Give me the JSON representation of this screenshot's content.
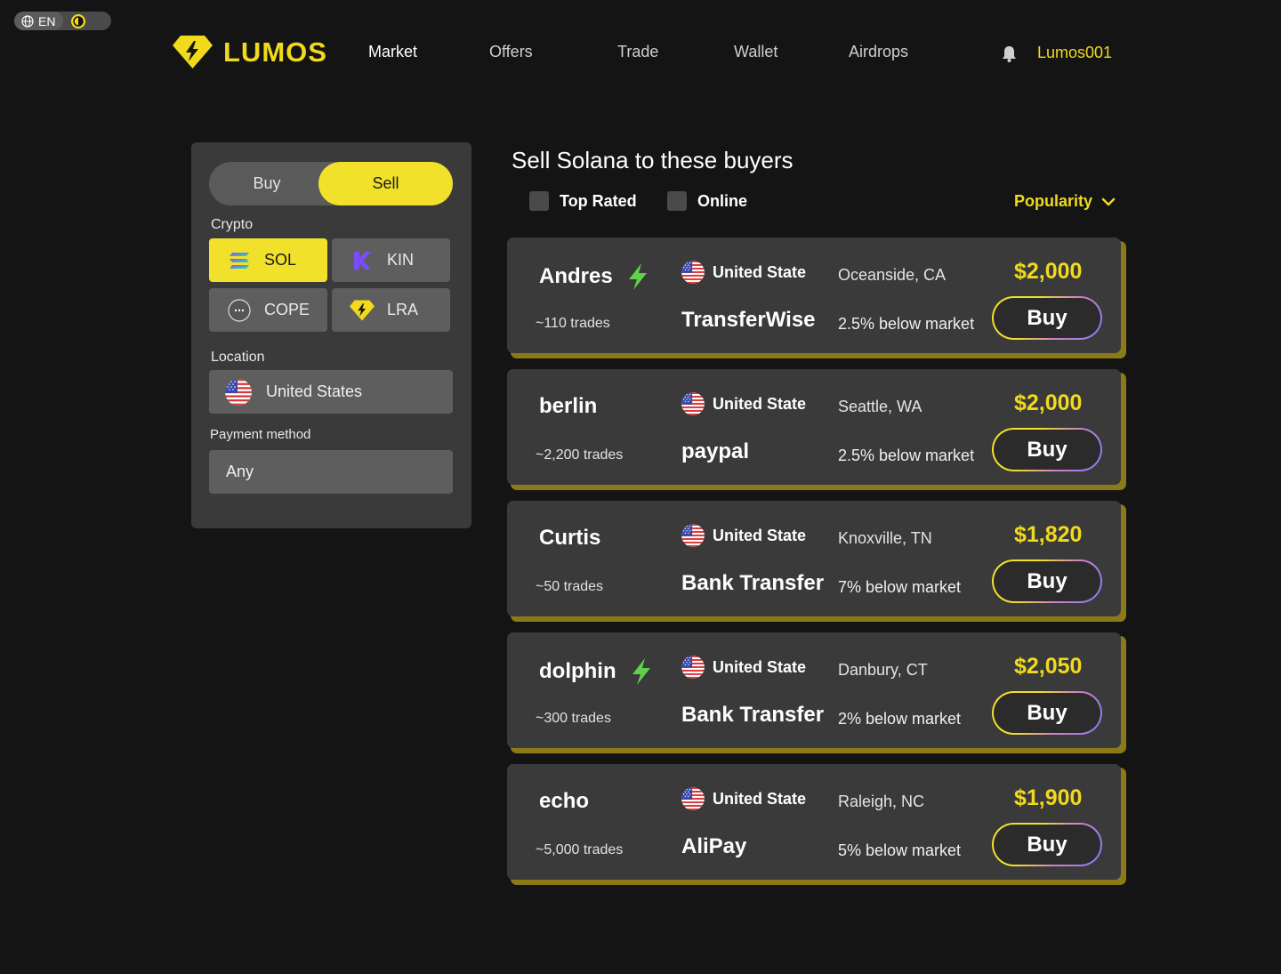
{
  "util": {
    "language": "EN"
  },
  "header": {
    "brand": "LUMOS",
    "nav": [
      "Market",
      "Offers",
      "Trade",
      "Wallet",
      "Airdrops"
    ],
    "active_nav": "Market",
    "username": "Lumos001"
  },
  "filters": {
    "toggle": {
      "buy": "Buy",
      "sell": "Sell",
      "selected": "Sell"
    },
    "crypto_label": "Crypto",
    "crypto": [
      {
        "symbol": "SOL",
        "icon": "solana-icon",
        "selected": true
      },
      {
        "symbol": "KIN",
        "icon": "kin-icon",
        "selected": false
      },
      {
        "symbol": "COPE",
        "icon": "cope-icon",
        "selected": false
      },
      {
        "symbol": "LRA",
        "icon": "lumos-icon",
        "selected": false
      }
    ],
    "location_label": "Location",
    "location": "United States",
    "payment_label": "Payment method",
    "payment": "Any"
  },
  "results": {
    "title": "Sell Solana to these buyers",
    "checks": [
      "Top Rated",
      "Online"
    ],
    "sort": "Popularity",
    "buy_label": "Buy",
    "offers": [
      {
        "name": "Andres",
        "verified": true,
        "trades": "~110 trades",
        "country": "United State",
        "method": "TransferWise",
        "city": "Oceanside, CA",
        "below": "2.5% below market",
        "price": "$2,000"
      },
      {
        "name": "berlin",
        "verified": false,
        "trades": "~2,200 trades",
        "country": "United State",
        "method": "paypal",
        "city": "Seattle, WA",
        "below": "2.5% below market",
        "price": "$2,000"
      },
      {
        "name": "Curtis",
        "verified": false,
        "trades": "~50 trades",
        "country": "United State",
        "method": "Bank Transfer",
        "city": "Knoxville, TN",
        "below": "7% below market",
        "price": "$1,820"
      },
      {
        "name": "dolphin",
        "verified": true,
        "trades": "~300 trades",
        "country": "United State",
        "method": "Bank Transfer",
        "city": "Danbury, CT",
        "below": "2% below market",
        "price": "$2,050"
      },
      {
        "name": "echo",
        "verified": false,
        "trades": "~5,000 trades",
        "country": "United State",
        "method": "AliPay",
        "city": "Raleigh, NC",
        "below": "5% below market",
        "price": "$1,900"
      }
    ]
  },
  "colors": {
    "accent": "#f1d91c",
    "verified": "#5fd14a",
    "panel": "#3a3a3a",
    "background": "#141414"
  }
}
